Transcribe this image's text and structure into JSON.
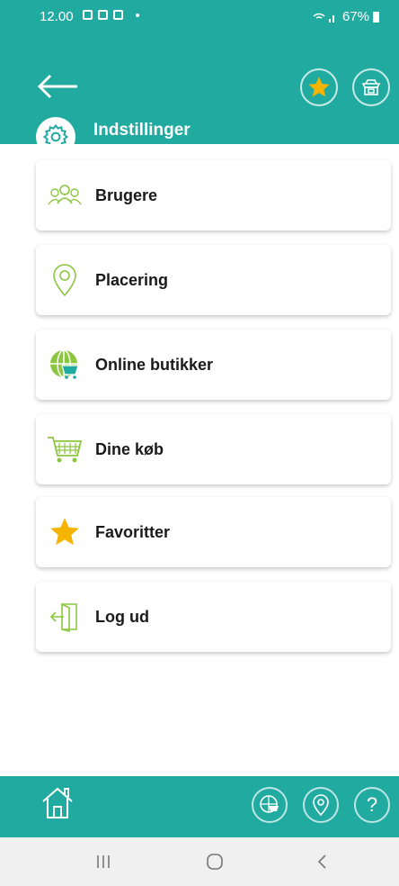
{
  "status_bar": {
    "time": "12.00",
    "battery": "67%"
  },
  "header": {
    "title": "Indstillinger"
  },
  "menu": [
    {
      "label": "Brugere",
      "icon": "users-icon"
    },
    {
      "label": "Placering",
      "icon": "location-pin-icon"
    },
    {
      "label": "Online butikker",
      "icon": "online-shop-icon"
    },
    {
      "label": "Dine køb",
      "icon": "shopping-cart-icon"
    },
    {
      "label": "Favoritter",
      "icon": "star-icon"
    },
    {
      "label": "Log ud",
      "icon": "logout-icon"
    }
  ],
  "bottom_bar": {
    "help": "?"
  },
  "colors": {
    "teal": "#21aaa0",
    "green_icon": "#8cc63f",
    "star": "#f4b400"
  }
}
